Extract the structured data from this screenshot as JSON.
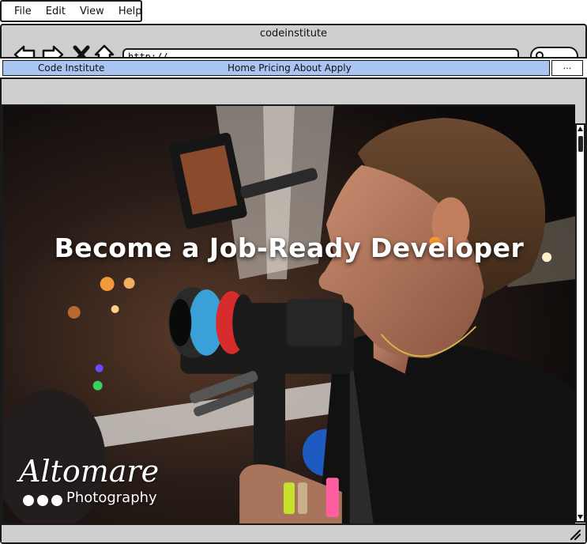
{
  "menubar": {
    "items": [
      "File",
      "Edit",
      "View",
      "Help"
    ]
  },
  "window": {
    "title": "codeinstitute"
  },
  "browser": {
    "url": "http://",
    "icons": [
      "back-arrow-icon",
      "forward-arrow-icon",
      "close-x-icon",
      "home-icon",
      "search-icon"
    ]
  },
  "appnav": {
    "brand": "Code Institute",
    "links": "Home Pricing About Apply",
    "more_label": "..."
  },
  "hero": {
    "headline": "Become a Job-Ready Developer",
    "watermark_line1": "Altomare",
    "watermark_line2": "Photography"
  },
  "colors": {
    "nav_bg": "#a9c5f2",
    "chrome": "#cfcfcf",
    "headline": "#ffffff"
  }
}
